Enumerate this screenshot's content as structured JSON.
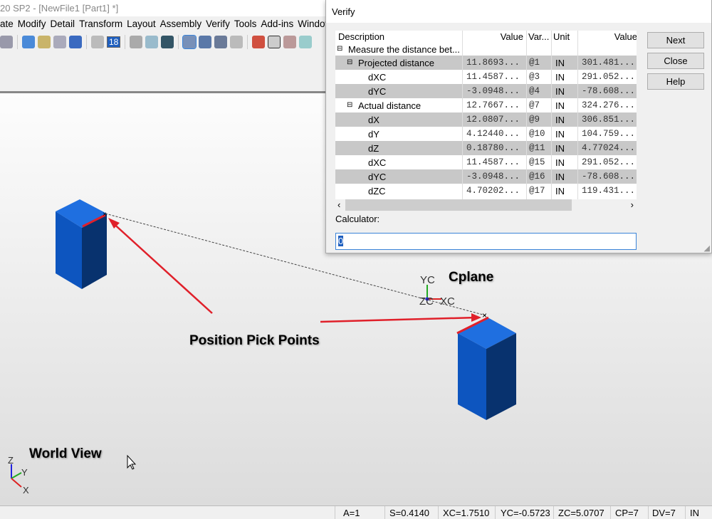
{
  "app": {
    "title": "20 SP2 - [NewFile1 [Part1] *]"
  },
  "menu": [
    "ate",
    "Modify",
    "Detail",
    "Transform",
    "Layout",
    "Assembly",
    "Verify",
    "Tools",
    "Add-ins",
    "Window"
  ],
  "toolbar": {
    "layer_value": "18"
  },
  "dialog": {
    "title": "Verify",
    "columns": [
      "Description",
      "Value",
      "Var...",
      "Unit",
      "Value"
    ],
    "root": "Measure the distance bet...",
    "rows": [
      {
        "desc": "Projected distance",
        "value": "11.8693...",
        "var": "@1",
        "unit": "IN",
        "value2": "301.481..."
      },
      {
        "desc": "dXC",
        "value": "11.4587...",
        "var": "@3",
        "unit": "IN",
        "value2": "291.052..."
      },
      {
        "desc": "dYC",
        "value": "-3.0948...",
        "var": "@4",
        "unit": "IN",
        "value2": "-78.608..."
      },
      {
        "desc": "Actual distance",
        "value": "12.7667...",
        "var": "@7",
        "unit": "IN",
        "value2": "324.276..."
      },
      {
        "desc": "dX",
        "value": "12.0807...",
        "var": "@9",
        "unit": "IN",
        "value2": "306.851..."
      },
      {
        "desc": "dY",
        "value": "4.12440...",
        "var": "@10",
        "unit": "IN",
        "value2": "104.759..."
      },
      {
        "desc": "dZ",
        "value": "0.18780...",
        "var": "@11",
        "unit": "IN",
        "value2": "4.77024..."
      },
      {
        "desc": "dXC",
        "value": "11.4587...",
        "var": "@15",
        "unit": "IN",
        "value2": "291.052..."
      },
      {
        "desc": "dYC",
        "value": "-3.0948...",
        "var": "@16",
        "unit": "IN",
        "value2": "-78.608..."
      },
      {
        "desc": "dZC",
        "value": "4.70202...",
        "var": "@17",
        "unit": "IN",
        "value2": "119.431..."
      }
    ],
    "buttons": {
      "next": "Next",
      "close": "Close",
      "help": "Help"
    },
    "calculator_label": "Calculator:",
    "calculator_value": "0"
  },
  "viewport": {
    "cplane_label": "Cplane",
    "pick_label": "Position Pick Points",
    "world_label": "World View",
    "axes": {
      "yc": "YC",
      "zc": "ZC",
      "xc": "XC",
      "z": "Z",
      "y": "Y",
      "x": "X"
    }
  },
  "status": [
    "A=1",
    "S=0.4140",
    "XC=1.7510",
    "YC=-0.5723",
    "ZC=5.0707",
    "CP=7",
    "DV=7",
    "IN"
  ],
  "colors": {
    "box_top": "#1f6fe0",
    "box_front": "#0c4a9e",
    "box_side": "#082f66",
    "arrow": "#e0202a"
  }
}
